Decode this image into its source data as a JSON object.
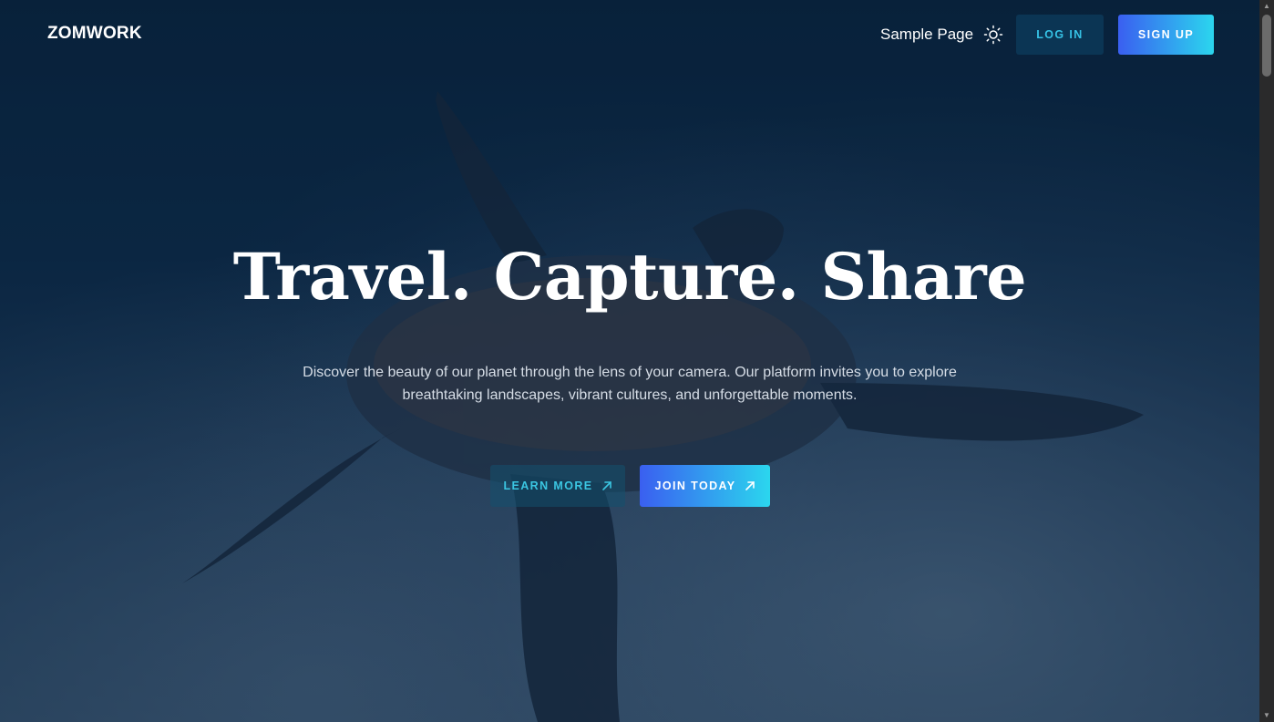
{
  "header": {
    "brand": "ZOMWORK",
    "nav": {
      "sample_page": "Sample Page"
    },
    "theme_toggle_icon": "sun-icon",
    "login_label": "LOG IN",
    "signup_label": "SIGN UP"
  },
  "hero": {
    "title": "Travel. Capture. Share",
    "subtitle": "Discover the beauty of our planet through the lens of your camera. Our platform invites you to explore breathtaking landscapes, vibrant cultures, and unforgettable moments.",
    "learn_more_label": "LEARN MORE",
    "join_today_label": "JOIN TODAY",
    "button_icon": "arrow-up-right-icon"
  },
  "colors": {
    "accent_cyan": "#36c2e6",
    "gradient_start": "#3a5ff0",
    "gradient_end": "#2bd6ee",
    "login_bg": "#0b3554"
  }
}
